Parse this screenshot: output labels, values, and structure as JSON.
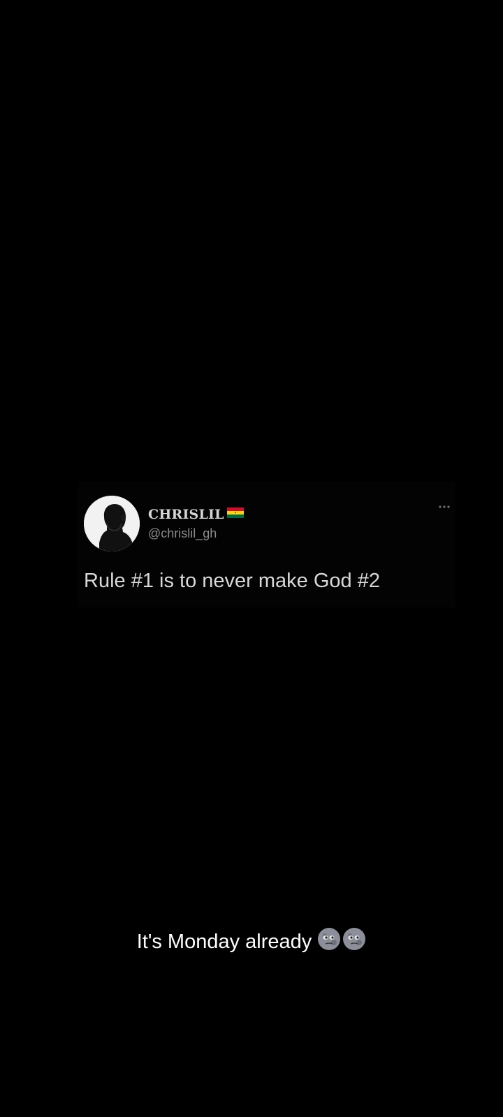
{
  "tweet": {
    "display_name": "CHRISLIL",
    "handle": "@chrislil_gh",
    "text": "Rule #1 is to never make God #2",
    "flag_icon": "ghana-flag-icon",
    "avatar_icon": "profile-silhouette-avatar",
    "more_icon": "more-options-icon"
  },
  "caption": {
    "text": "It's Monday already",
    "emoji_icon": "new-moon-face-emoji",
    "emoji_count": 2
  },
  "colors": {
    "background": "#000000",
    "name": "#d6d6d6",
    "handle": "#8b8b8b",
    "text": "#d8d8d8",
    "caption": "#ffffff",
    "flag_red": "#ce1126",
    "flag_gold": "#fcd116",
    "flag_green": "#006b3f"
  }
}
